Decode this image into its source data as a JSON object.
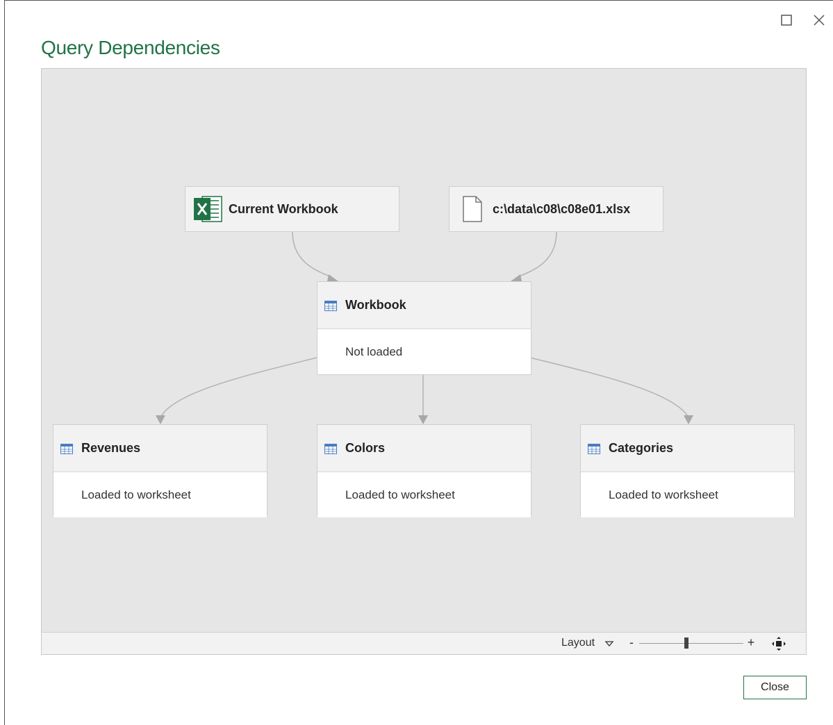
{
  "window": {
    "title": "Query Dependencies",
    "maximize_icon": "maximize-icon",
    "close_icon": "close-icon"
  },
  "diagram": {
    "sources": [
      {
        "label": "Current Workbook",
        "icon": "excel-icon"
      },
      {
        "label": "c:\\data\\c08\\c08e01.xlsx",
        "icon": "file-icon"
      }
    ],
    "hub": {
      "label": "Workbook",
      "status": "Not loaded",
      "icon": "table-icon"
    },
    "queries": [
      {
        "label": "Revenues",
        "status": "Loaded to worksheet",
        "icon": "table-icon"
      },
      {
        "label": "Colors",
        "status": "Loaded to worksheet",
        "icon": "table-icon"
      },
      {
        "label": "Categories",
        "status": "Loaded to worksheet",
        "icon": "table-icon"
      }
    ]
  },
  "statusbar": {
    "layout_label": "Layout",
    "zoom_minus": "-",
    "zoom_plus": "+",
    "zoom_level": 0.45
  },
  "footer": {
    "close_label": "Close"
  },
  "colors": {
    "accent": "#217346",
    "canvas": "#e6e6e6",
    "node": "#f2f2f2",
    "edge": "#a8a8a8"
  }
}
